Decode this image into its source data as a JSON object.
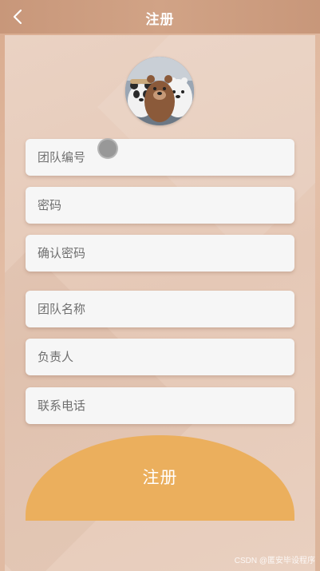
{
  "header": {
    "title": "注册",
    "back_icon": "chevron-left-icon"
  },
  "avatar": {
    "alt": "avatar"
  },
  "form": {
    "team_id": {
      "placeholder": "团队编号",
      "value": ""
    },
    "password": {
      "placeholder": "密码",
      "value": ""
    },
    "confirm_password": {
      "placeholder": "确认密码",
      "value": ""
    },
    "team_name": {
      "placeholder": "团队名称",
      "value": ""
    },
    "leader": {
      "placeholder": "负责人",
      "value": ""
    },
    "phone": {
      "placeholder": "联系电话",
      "value": ""
    }
  },
  "submit_label": "注册",
  "watermark": "CSDN @匿安毕设程序",
  "colors": {
    "header": "#c8977a",
    "button": "#ebaf5d",
    "field_bg": "#f6f6f6"
  }
}
